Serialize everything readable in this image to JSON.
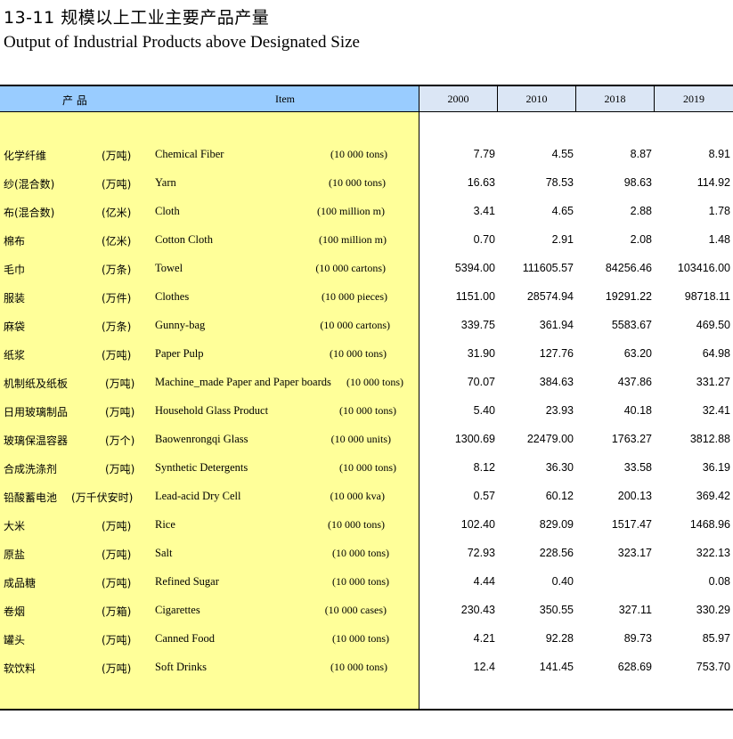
{
  "title_cn": "13-11   规模以上工业主要产品产量",
  "title_en": "Output of Industrial Products above Designated Size",
  "header": {
    "product": "产 品",
    "item": "Item",
    "years": [
      "2000",
      "2010",
      "2018",
      "2019"
    ]
  },
  "rows": [
    {
      "cn": "化学纤维",
      "cn_unit": "(万吨)",
      "en": "Chemical Fiber",
      "en_unit": "(10 000 tons)",
      "v": [
        "7.79",
        "4.55",
        "8.87",
        "8.91"
      ]
    },
    {
      "cn": "纱(混合数)",
      "cn_unit": "(万吨)",
      "en": "Yarn",
      "en_unit": "(10 000 tons)",
      "v": [
        "16.63",
        "78.53",
        "98.63",
        "114.92"
      ]
    },
    {
      "cn": "布(混合数)",
      "cn_unit": "(亿米)",
      "en": "Cloth",
      "en_unit": "(100 million m)",
      "v": [
        "3.41",
        "4.65",
        "2.88",
        "1.78"
      ]
    },
    {
      "cn": "棉布",
      "cn_unit": "(亿米)",
      "en": "Cotton Cloth",
      "en_unit": "(100 million m)",
      "v": [
        "0.70",
        "2.91",
        "2.08",
        "1.48"
      ]
    },
    {
      "cn": "毛巾",
      "cn_unit": "(万条)",
      "en": "Towel",
      "en_unit": "(10 000 cartons)",
      "v": [
        "5394.00",
        "111605.57",
        "84256.46",
        "103416.00"
      ]
    },
    {
      "cn": "服装",
      "cn_unit": "(万件)",
      "en": "Clothes",
      "en_unit": "(10 000 pieces)",
      "v": [
        "1151.00",
        "28574.94",
        "19291.22",
        "98718.11"
      ]
    },
    {
      "cn": "麻袋",
      "cn_unit": "(万条)",
      "en": "Gunny-bag",
      "en_unit": "(10 000 cartons)",
      "v": [
        "339.75",
        "361.94",
        "5583.67",
        "469.50"
      ]
    },
    {
      "cn": "纸浆",
      "cn_unit": "(万吨)",
      "en": "Paper Pulp",
      "en_unit": "(10 000 tons)",
      "v": [
        "31.90",
        "127.76",
        "63.20",
        "64.98"
      ]
    },
    {
      "cn": "机制纸及纸板",
      "cn_unit": "(万吨)",
      "en": "Machine_made Paper and Paper boards",
      "en_unit": "(10 000 tons)",
      "v": [
        "70.07",
        "384.63",
        "437.86",
        "331.27"
      ]
    },
    {
      "cn": "日用玻璃制品",
      "cn_unit": "(万吨)",
      "en": "Household Glass Product",
      "en_unit": "(10 000 tons)",
      "v": [
        "5.40",
        "23.93",
        "40.18",
        "32.41"
      ]
    },
    {
      "cn": "玻璃保温容器",
      "cn_unit": "(万个)",
      "en": "Baowenrongqi Glass",
      "en_unit": "(10 000 units)",
      "v": [
        "1300.69",
        "22479.00",
        "1763.27",
        "3812.88"
      ]
    },
    {
      "cn": "合成洗涤剂",
      "cn_unit": "(万吨)",
      "en": "Synthetic Detergents",
      "en_unit": "(10 000 tons)",
      "v": [
        "8.12",
        "36.30",
        "33.58",
        "36.19"
      ]
    },
    {
      "cn": "铅酸蓄电池",
      "cn_unit": "(万千伏安时)",
      "en": "Lead-acid Dry Cell",
      "en_unit": "(10 000 kva)",
      "v": [
        "0.57",
        "60.12",
        "200.13",
        "369.42"
      ]
    },
    {
      "cn": "大米",
      "cn_unit": "(万吨)",
      "en": "Rice",
      "en_unit": "(10 000 tons)",
      "v": [
        "102.40",
        "829.09",
        "1517.47",
        "1468.96"
      ]
    },
    {
      "cn": "原盐",
      "cn_unit": "(万吨)",
      "en": "Salt",
      "en_unit": "(10 000 tons)",
      "v": [
        "72.93",
        "228.56",
        "323.17",
        "322.13"
      ]
    },
    {
      "cn": "成品糖",
      "cn_unit": "(万吨)",
      "en": "Refined Sugar",
      "en_unit": "(10 000 tons)",
      "v": [
        "4.44",
        "0.40",
        "",
        "0.08"
      ]
    },
    {
      "cn": "卷烟",
      "cn_unit": "(万箱)",
      "en": "Cigarettes",
      "en_unit": "(10 000 cases)",
      "v": [
        "230.43",
        "350.55",
        "327.11",
        "330.29"
      ]
    },
    {
      "cn": "罐头",
      "cn_unit": "(万吨)",
      "en": "Canned Food",
      "en_unit": "(10 000 tons)",
      "v": [
        "4.21",
        "92.28",
        "89.73",
        "85.97"
      ]
    },
    {
      "cn": "软饮料",
      "cn_unit": "(万吨)",
      "en": "Soft Drinks",
      "en_unit": "(10 000 tons)",
      "v": [
        "12.4",
        "141.45",
        "628.69",
        "753.70"
      ]
    }
  ]
}
